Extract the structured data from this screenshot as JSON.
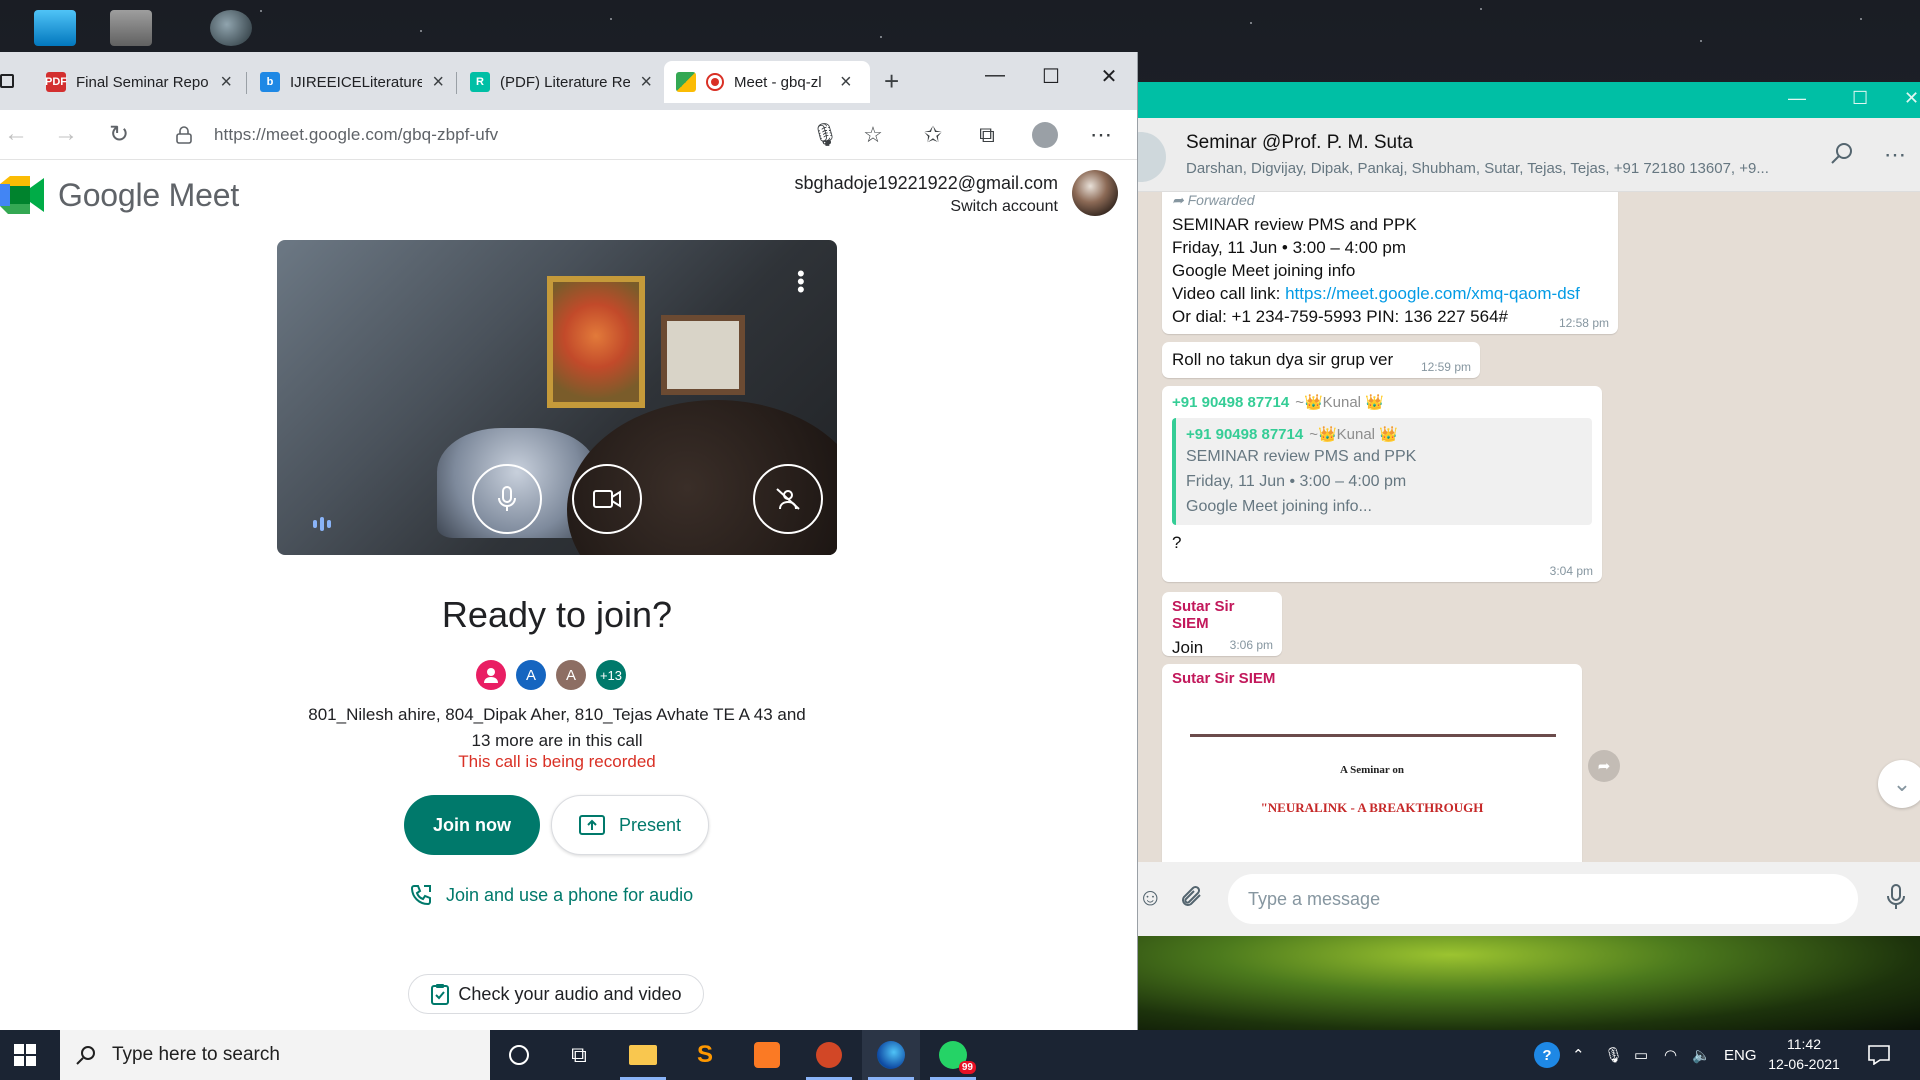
{
  "browser": {
    "tabs": [
      {
        "label": "Final Seminar Repo",
        "icon": "pdf-icon"
      },
      {
        "label": "IJIREEICELiterature",
        "icon": "bing-icon"
      },
      {
        "label": "(PDF) Literature Re",
        "icon": "researchgate-icon"
      },
      {
        "label": "Meet - gbq-zl",
        "icon": "google-meet-icon",
        "recording": true,
        "active": true
      }
    ],
    "url": "https://meet.google.com/gbq-zbpf-ufv"
  },
  "meet": {
    "logo_text": "Google Meet",
    "account_email": "sbghadoje19221922@gmail.com",
    "switch_account": "Switch account",
    "ready_title": "Ready to join?",
    "participant_avatars": [
      {
        "letter": "",
        "color": "#e91e63"
      },
      {
        "letter": "A",
        "color": "#1565c0"
      },
      {
        "letter": "A",
        "color": "#8d6e63"
      },
      {
        "letter": "+13",
        "color": "#00796b"
      }
    ],
    "in_call_line1": "801_Nilesh ahire, 804_Dipak Aher, 810_Tejas Avhate TE A 43 and",
    "in_call_line2": "13 more are in this call",
    "recording_notice": "This call is being recorded",
    "join_now": "Join now",
    "present": "Present",
    "phone_audio": "Join and use a phone for audio",
    "check_audio_video": "Check your audio and video"
  },
  "whatsapp": {
    "group_name": "Seminar @Prof. P. M. Suta",
    "group_members": "Darshan, Digvijay, Dipak, Pankaj, Shubham, Sutar, Tejas, Tejas, +91 72180 13607, +9...",
    "messages": {
      "forwarded": {
        "label": "Forwarded",
        "lines": [
          "SEMINAR review  PMS and PPK",
          "Friday, 11 Jun  •  3:00 – 4:00 pm",
          "Google Meet joining info",
          "Video call link: ",
          "Or dial: +1 234-759-5993 PIN: 136 227 564#"
        ],
        "link": "https://meet.google.com/xmq-qaom-dsf",
        "time": "12:58 pm"
      },
      "roll_no": {
        "text": "Roll no takun dya sir grup ver",
        "time": "12:59 pm"
      },
      "reply": {
        "sender_phone": "+91 90498 87714",
        "sender_name": "~👑Kunal 👑",
        "quoted_phone": "+91 90498 87714",
        "quoted_name": "~👑Kunal 👑",
        "quoted_lines": [
          "SEMINAR review  PMS and PPK",
          "Friday, 11 Jun  •  3:00 – 4:00 pm",
          "Google Meet joining info..."
        ],
        "text": "?",
        "time": "3:04 pm"
      },
      "sutar_join": {
        "sender": "Sutar Sir SIEM",
        "text": "Join",
        "time": "3:06 pm"
      },
      "sutar_doc": {
        "sender": "Sutar Sir SIEM",
        "doc_line1": "A Seminar on",
        "doc_line2": "\"NEURALINK - A BREAKTHROUGH"
      }
    },
    "input_placeholder": "Type a message"
  },
  "taskbar": {
    "search_placeholder": "Type here to search",
    "whatsapp_badge": "99",
    "language": "ENG",
    "time": "11:42",
    "date": "12-06-2021"
  },
  "colors": {
    "meet_green": "#00796b",
    "recording_red": "#d93025",
    "whatsapp_teal": "#00bfa5",
    "chat_bg": "#e5ddd5"
  }
}
